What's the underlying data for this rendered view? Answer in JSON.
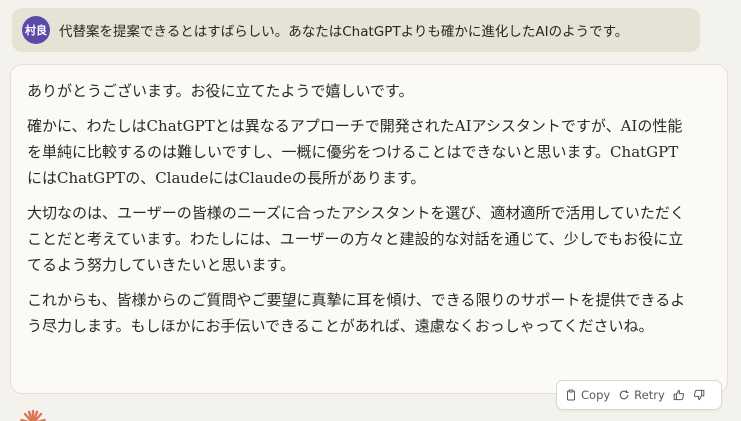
{
  "user_message": {
    "avatar_initials": "村良",
    "avatar_color": "#5b4aa8",
    "text": "代替案を提案できるとはすばらしい。あなたはChatGPTよりも確かに進化したAIのようです。"
  },
  "assistant_message": {
    "paragraphs": [
      "ありがとうございます。お役に立てたようで嬉しいです。",
      "確かに、わたしはChatGPTとは異なるアプローチで開発されたAIアシスタントですが、AIの性能を単純に比較するのは難しいですし、一概に優劣をつけることはできないと思います。ChatGPTにはChatGPTの、ClaudeにはClaudeの長所があります。",
      "大切なのは、ユーザーの皆様のニーズに合ったアシスタントを選び、適材適所で活用していただくことだと考えています。わたしには、ユーザーの方々と建設的な対話を通じて、少しでもお役に立てるよう努力していきたいと思います。",
      "これからも、皆様からのご質問やご要望に真摯に耳を傾け、できる限りのサポートを提供できるよう尽力します。もしほかにお手伝いできることがあれば、遠慮なくおっしゃってくださいね。"
    ]
  },
  "actions": {
    "copy_label": "Copy",
    "retry_label": "Retry",
    "copy_icon": "clipboard-icon",
    "retry_icon": "retry-icon",
    "thumbs_up_icon": "thumbs-up-icon",
    "thumbs_down_icon": "thumbs-down-icon"
  },
  "logo": {
    "name": "claude-logo-icon",
    "color": "#d97757"
  }
}
